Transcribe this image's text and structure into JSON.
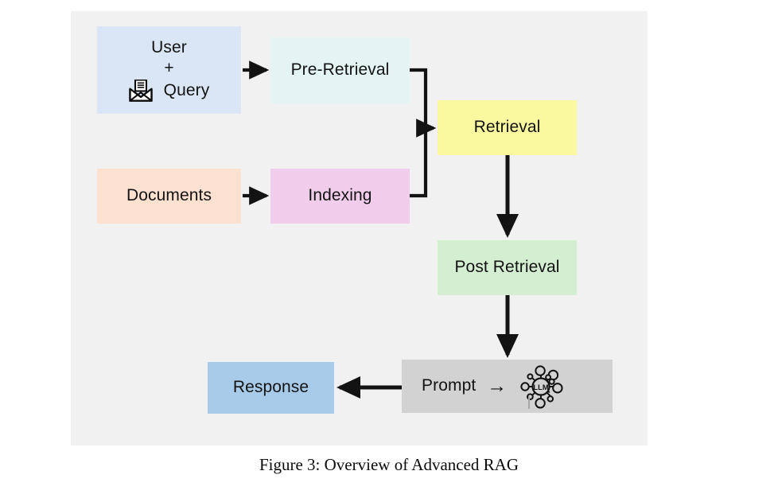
{
  "figure": {
    "caption": "Figure 3: Overview of Advanced RAG",
    "panel_background": "#f1f1f1",
    "page_background": "#ffffff",
    "stroke_color": "#131313"
  },
  "nodes": [
    {
      "id": "user",
      "label": "User",
      "label_extra": "+",
      "label_query": "Query",
      "icon": "envelope-icon",
      "color": "#dae6f5"
    },
    {
      "id": "pre",
      "label": "Pre-Retrieval",
      "color": "#e4f4f3"
    },
    {
      "id": "documents",
      "label": "Documents",
      "color": "#fce0d0"
    },
    {
      "id": "indexing",
      "label": "Indexing",
      "color": "#f2cdeb"
    },
    {
      "id": "retrieval",
      "label": "Retrieval",
      "color": "#fbf9a0"
    },
    {
      "id": "post",
      "label": "Post Retrieval",
      "color": "#d4eed2"
    },
    {
      "id": "prompt",
      "label": "Prompt",
      "arrow_glyph": "→",
      "icon": "llm-network-icon",
      "icon_label": "LLM",
      "color": "#d2d2d2"
    },
    {
      "id": "response",
      "label": "Response",
      "color": "#a7cbe9"
    }
  ],
  "edges": [
    {
      "id": "user-to-pre",
      "from": "user",
      "to": "pre",
      "style": "straight-right"
    },
    {
      "id": "documents-to-indexing",
      "from": "documents",
      "to": "indexing",
      "style": "straight-right"
    },
    {
      "id": "pre-to-retrieval",
      "from": "pre",
      "to": "retrieval",
      "style": "elbow-merge"
    },
    {
      "id": "indexing-to-retrieval",
      "from": "indexing",
      "to": "retrieval",
      "style": "elbow-merge"
    },
    {
      "id": "retrieval-to-post",
      "from": "retrieval",
      "to": "post",
      "style": "straight-down"
    },
    {
      "id": "post-to-prompt",
      "from": "post",
      "to": "prompt",
      "style": "straight-down"
    },
    {
      "id": "prompt-to-response",
      "from": "prompt",
      "to": "response",
      "style": "straight-left"
    }
  ]
}
